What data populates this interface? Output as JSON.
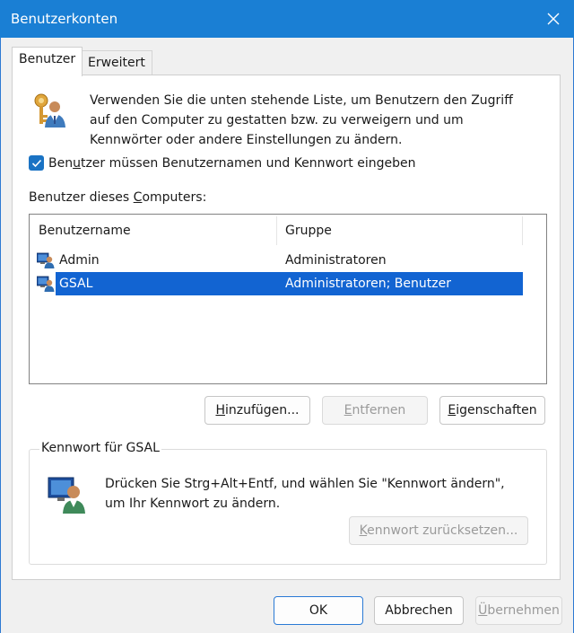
{
  "window": {
    "title": "Benutzerkonten"
  },
  "tabs": [
    {
      "label": "Benutzer",
      "active": true
    },
    {
      "label": "Erweitert",
      "active": false
    }
  ],
  "intro": {
    "text_line1": "Verwenden Sie die unten stehende Liste, um Benutzern den Zugriff",
    "text_line2": "auf den Computer zu gestatten bzw. zu verweigern und um",
    "text_line3": "Kennwörter oder andere Einstellungen zu ändern."
  },
  "checkbox": {
    "label_pre": "Ben",
    "label_acc": "u",
    "label_post": "tzer müssen Benutzernamen und Kennwort eingeben",
    "checked": true
  },
  "users_section": {
    "label_pre": "Benutzer dieses ",
    "label_acc": "C",
    "label_post": "omputers:"
  },
  "user_list": {
    "columns": [
      "Benutzername",
      "Gruppe"
    ],
    "rows": [
      {
        "username": "Admin",
        "group": "Administratoren",
        "selected": false
      },
      {
        "username": "GSAL",
        "group": "Administratoren; Benutzer",
        "selected": true
      }
    ]
  },
  "buttons": {
    "add": {
      "pre": "",
      "acc": "H",
      "post": "inzufügen..."
    },
    "remove": {
      "pre": "",
      "acc": "E",
      "post": "ntfernen"
    },
    "properties": {
      "pre": "",
      "acc": "E",
      "post": "igenschaften"
    }
  },
  "password_group": {
    "title": "Kennwort für GSAL",
    "text_line1": "Drücken Sie Strg+Alt+Entf, und wählen Sie \"Kennwort ändern\",",
    "text_line2": "um Ihr Kennwort zu ändern.",
    "reset_button": {
      "pre": "",
      "acc": "K",
      "post": "ennwort zurücksetzen..."
    }
  },
  "footer": {
    "ok": "OK",
    "cancel": "Abbrechen",
    "apply": {
      "pre": "",
      "acc": "Ü",
      "post": "bernehmen"
    }
  },
  "colors": {
    "titlebar": "#1a7fd4",
    "selection": "#1264d2",
    "checkbox": "#1a73c4"
  }
}
